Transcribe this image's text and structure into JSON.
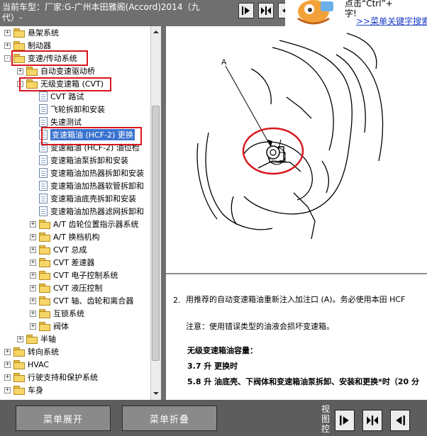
{
  "header": {
    "title": "当前车型：厂家:G-广州本田雅阁(Accord)2014（九代）-",
    "nav_buttons": [
      "arrow-right-bar-icon",
      "split-arrows-icon",
      "arrow-left-bar-icon"
    ],
    "ad": {
      "line1": "点击“Ctrl”+",
      "line2": "字!",
      "link": ">>菜单关键字搜索"
    }
  },
  "tree": {
    "items": [
      {
        "label": "悬架系统",
        "depth": 0,
        "type": "folder",
        "expander": "+"
      },
      {
        "label": "制动器",
        "depth": 0,
        "type": "folder",
        "expander": "+"
      },
      {
        "label": "变速/传动系统",
        "depth": 0,
        "type": "folder-open",
        "expander": "-"
      },
      {
        "label": "自动变速驱动桥",
        "depth": 1,
        "type": "folder",
        "expander": "+"
      },
      {
        "label": "无级变速箱 (CVT)",
        "depth": 1,
        "type": "folder-open",
        "expander": "-"
      },
      {
        "label": "CVT 路试",
        "depth": 2,
        "type": "doc"
      },
      {
        "label": "飞轮拆卸和安装",
        "depth": 2,
        "type": "doc"
      },
      {
        "label": "失速测试",
        "depth": 2,
        "type": "doc"
      },
      {
        "label": "变速箱油 (HCF-2) 更换",
        "depth": 2,
        "type": "doc",
        "selected": true
      },
      {
        "label": "变速箱油 (HCF-2) 油位检",
        "depth": 2,
        "type": "doc"
      },
      {
        "label": "变速箱油泵拆卸和安装",
        "depth": 2,
        "type": "doc"
      },
      {
        "label": "变速箱油加热器拆卸和安装",
        "depth": 2,
        "type": "doc"
      },
      {
        "label": "变速箱油加热器软管拆卸和",
        "depth": 2,
        "type": "doc"
      },
      {
        "label": "变速箱油底壳拆卸和安装",
        "depth": 2,
        "type": "doc"
      },
      {
        "label": "变速箱油加热器滤网拆卸和",
        "depth": 2,
        "type": "doc"
      },
      {
        "label": "A/T 齿轮位置指示器系统",
        "depth": 2,
        "type": "folder",
        "expander": "+"
      },
      {
        "label": "A/T 换档机构",
        "depth": 2,
        "type": "folder",
        "expander": "+"
      },
      {
        "label": "CVT 总成",
        "depth": 2,
        "type": "folder",
        "expander": "+"
      },
      {
        "label": "CVT 差速器",
        "depth": 2,
        "type": "folder",
        "expander": "+"
      },
      {
        "label": "CVT 电子控制系统",
        "depth": 2,
        "type": "folder",
        "expander": "+"
      },
      {
        "label": "CVT 液压控制",
        "depth": 2,
        "type": "folder",
        "expander": "+"
      },
      {
        "label": "CVT 轴、齿轮和离合器",
        "depth": 2,
        "type": "folder",
        "expander": "+"
      },
      {
        "label": "互锁系统",
        "depth": 2,
        "type": "folder",
        "expander": "+"
      },
      {
        "label": "阀体",
        "depth": 2,
        "type": "folder",
        "expander": "+"
      },
      {
        "label": "半轴",
        "depth": 1,
        "type": "folder",
        "expander": "+"
      },
      {
        "label": "转向系统",
        "depth": 0,
        "type": "folder",
        "expander": "+"
      },
      {
        "label": "HVAC",
        "depth": 0,
        "type": "folder",
        "expander": "+"
      },
      {
        "label": "行驶支持和保护系统",
        "depth": 0,
        "type": "folder",
        "expander": "+"
      },
      {
        "label": "车身",
        "depth": 0,
        "type": "folder",
        "expander": "+"
      }
    ]
  },
  "content": {
    "figure_label": "A",
    "step_number": "2.",
    "step_text": "用推荐的自动变速箱油重新注入加注口 (A)。务必使用本田 HCF",
    "note": "注意：使用错误类型的油液会损坏变速箱。",
    "capacity_heading": "无级变速箱油容量：",
    "capacity_1": "3.7 升 更换时",
    "capacity_2": "5.8 升 油底壳、下阀体和变速箱油泵拆卸、安装和更换*时（20 分"
  },
  "footer": {
    "expand_label": "菜单展开",
    "collapse_label": "菜单折叠",
    "view_label": "视图控",
    "view_buttons": [
      "arrow-right-bar-icon",
      "split-arrows-icon",
      "arrow-left-bar-icon"
    ]
  },
  "colors": {
    "highlight_red": "#d8161c",
    "selection_blue": "#3a73d0",
    "chrome_gray": "#6e6e6e"
  }
}
